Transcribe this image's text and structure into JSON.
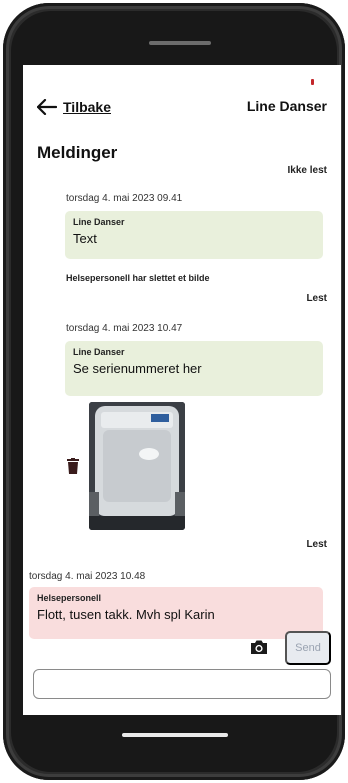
{
  "header": {
    "back_label": "Tilbake",
    "contact_name": "Line Danser"
  },
  "page_title": "Meldinger",
  "messages": [
    {
      "read_status": "Ikke lest",
      "timestamp": "torsdag 4. mai 2023 09.41",
      "sender": "Line Danser",
      "text": "Text"
    },
    {
      "notice": "Helsepersonell har slettet et bilde",
      "read_status": "Lest"
    },
    {
      "timestamp": "torsdag 4. mai 2023 10.47",
      "sender": "Line Danser",
      "text": "Se serienummeret her",
      "read_status": "Lest"
    },
    {
      "timestamp": "torsdag 4. mai 2023 10.48",
      "sender": "Helsepersonell",
      "text": "Flott, tusen takk. Mvh spl Karin"
    }
  ],
  "composer": {
    "send_label": "Send",
    "input_value": "",
    "input_placeholder": ""
  },
  "colors": {
    "patient_bubble": "#e9f0dc",
    "staff_bubble": "#f9dddd",
    "send_disabled_bg": "#e8ebf0",
    "send_disabled_text": "#9aa3b1"
  },
  "icons": {
    "back": "arrow-left-icon",
    "trash": "trash-icon",
    "camera": "camera-icon"
  }
}
